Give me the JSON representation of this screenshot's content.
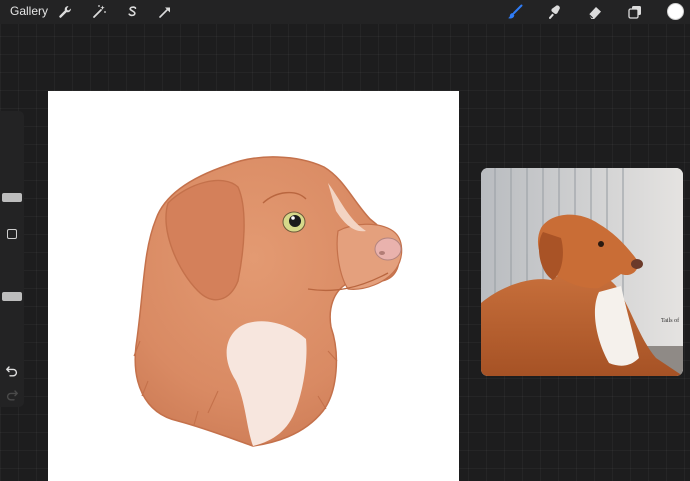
{
  "toolbar": {
    "gallery_label": "Gallery",
    "left_tools": [
      "wrench-icon",
      "magic-wand-icon",
      "selection-icon",
      "transform-arrow-icon"
    ],
    "right_tools": [
      "brush-icon",
      "smudge-icon",
      "eraser-icon",
      "layers-icon"
    ],
    "active_tool": "brush-icon",
    "accent_color": "#2f7cf6",
    "current_color": "#ffffff"
  },
  "sidebar": {
    "brush_size": 0.22,
    "opacity": 0.53,
    "icons": [
      "modify-button",
      "undo-icon",
      "redo-icon"
    ]
  },
  "reference": {
    "watermark": "Tails of"
  },
  "colors": {
    "dog_fur": "#d98a63",
    "dog_fur_dark": "#c4714b",
    "chest": "#f7e6de",
    "eye": "#d6d98a",
    "nose": "#e9b2ad"
  }
}
